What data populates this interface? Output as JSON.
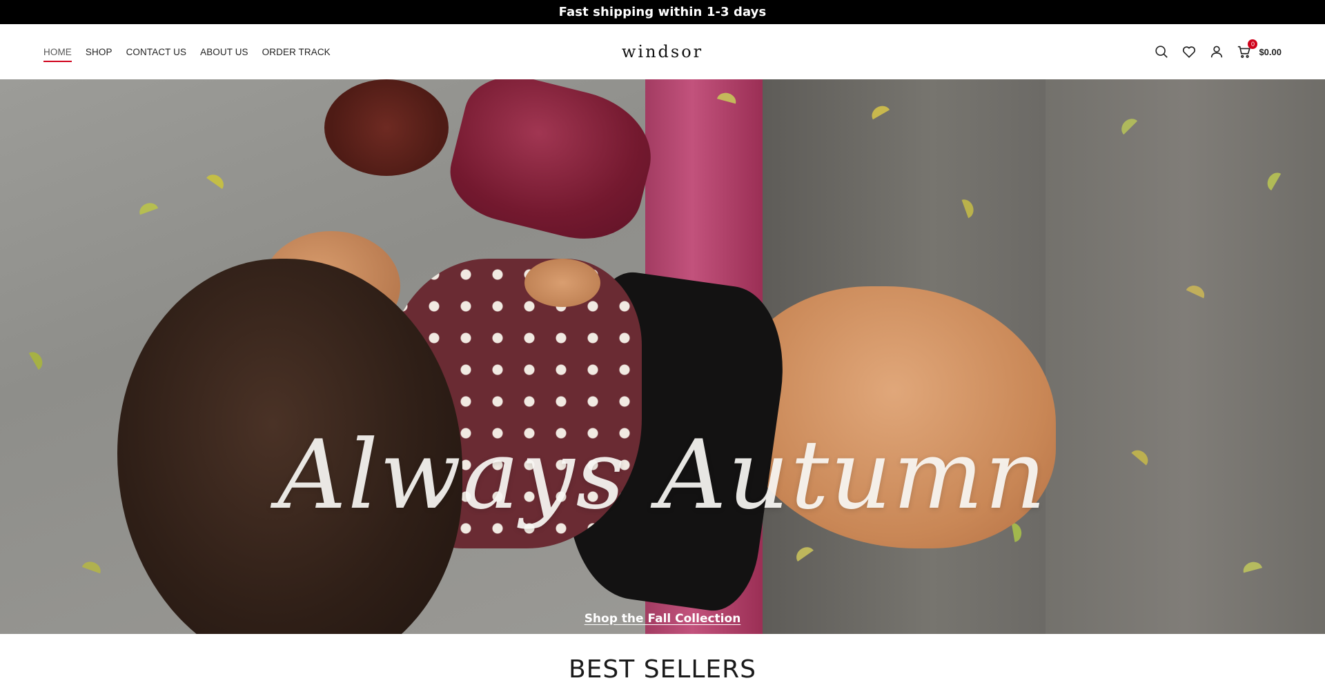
{
  "announcement": {
    "text": "Fast shipping within 1-3 days"
  },
  "header": {
    "nav": [
      {
        "label": "HOME",
        "active": true
      },
      {
        "label": "SHOP"
      },
      {
        "label": "CONTACT US"
      },
      {
        "label": "ABOUT US"
      },
      {
        "label": "ORDER TRACK"
      }
    ],
    "logo": "windsor",
    "tools": {
      "icons": [
        "search-icon",
        "heart-icon",
        "user-icon",
        "cart-icon"
      ],
      "cart_count": "0",
      "cart_total": "$0.00"
    }
  },
  "hero": {
    "title": "Always Autumn",
    "cta": "Shop the Fall Collection"
  },
  "section": {
    "best_sellers": "BEST SELLERS"
  },
  "colors": {
    "accent": "#d0021b",
    "announcement_bg": "#000000"
  }
}
